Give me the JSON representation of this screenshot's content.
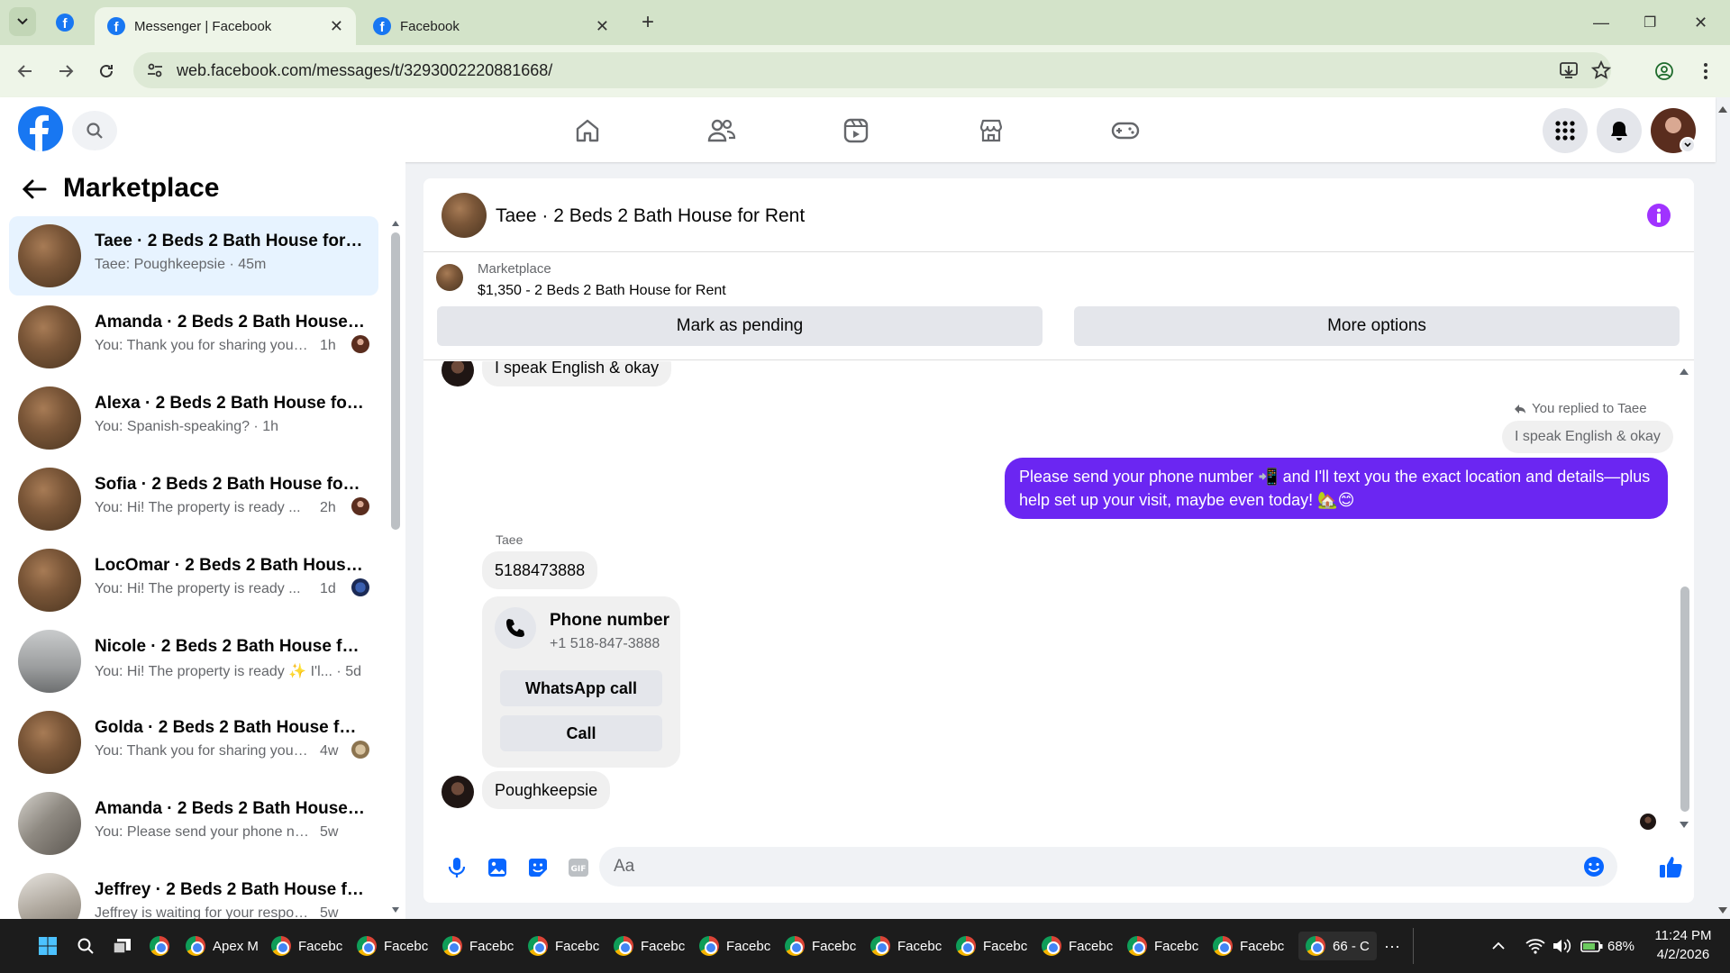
{
  "browser": {
    "tabs": [
      {
        "title": "Messenger | Facebook",
        "active": true
      },
      {
        "title": "Facebook",
        "active": false
      }
    ],
    "url": "web.facebook.com/messages/t/3293002220881668/",
    "colors": {
      "frame": "#d3e3c9",
      "toolbar": "#eef5e8"
    }
  },
  "fb": {
    "brand_color": "#1877f2",
    "nav_icons": [
      "home-icon",
      "friends-icon",
      "video-icon",
      "marketplace-icon",
      "gaming-icon"
    ],
    "right_icons": [
      "menu-grid-icon",
      "notifications-bell-icon",
      "account-avatar"
    ]
  },
  "sidebar": {
    "title": "Marketplace",
    "conversations": [
      {
        "name": "Taee · 2 Beds 2 Bath House for Rent",
        "preview": "Taee: Poughkeepsie",
        "time": "45m",
        "selected": true
      },
      {
        "name": "Amanda · 2 Beds 2 Bath House for Rent",
        "preview": "You: Thank you for sharing your ...",
        "time": "1h"
      },
      {
        "name": "Alexa · 2 Beds 2 Bath House for Rent",
        "preview": "You: Spanish-speaking?",
        "time": "1h"
      },
      {
        "name": "Sofia · 2 Beds 2 Bath House for Rent",
        "preview": "You: Hi! The property is ready ...",
        "time": "2h"
      },
      {
        "name": "LocOmar · 2 Beds 2 Bath House for Rent",
        "preview": "You: Hi! The property is ready ...",
        "time": "1d"
      },
      {
        "name": "Nicole · 2 Beds 2 Bath House for Rent",
        "preview": "You: Hi! The property is ready ✨ I'l...",
        "time": "5d"
      },
      {
        "name": "Golda · 2 Beds 2 Bath House for Rent",
        "preview": "You: Thank you for sharing your ...",
        "time": "4w"
      },
      {
        "name": "Amanda · 2 Beds 2 Bath House for Rent",
        "preview": "You: Please send your phone numb...",
        "time": "5w"
      },
      {
        "name": "Jeffrey · 2 Beds 2 Bath House for Rent",
        "preview": "Jeffrey is waiting for your response",
        "time": "5w"
      }
    ]
  },
  "chat": {
    "title": "Taee · 2 Beds 2 Bath House for Rent",
    "marketplace": {
      "label": "Marketplace",
      "listing": "$1,350 - 2 Beds 2 Bath House for Rent",
      "pending_button": "Mark as pending",
      "more_button": "More options"
    },
    "messages": {
      "incoming_top": "I speak English & okay",
      "reply_note": "You replied to Taee",
      "quoted": "I speak English & okay",
      "outgoing": "Please send your phone number 📲 and I'll text you the exact location and details—plus help set up your visit, maybe even today! 🏡😊",
      "sender_name": "Taee",
      "phone_text": "5188473888",
      "phone_card": {
        "title": "Phone number",
        "number": "+1 518-847-3888",
        "whatsapp_button": "WhatsApp call",
        "call_button": "Call"
      },
      "last": "Poughkeepsie"
    },
    "composer_placeholder": "Aa",
    "accent": "#6b26f2"
  },
  "taskbar": {
    "apps": [
      "Apex M",
      "Facebc",
      "Facebc",
      "Facebc",
      "Facebc",
      "Facebc",
      "Facebc",
      "Facebc",
      "Facebc",
      "Facebc",
      "Facebc",
      "Facebc",
      "Facebc",
      "66 - C"
    ],
    "more": "···",
    "battery": "68%",
    "time": "11:24 PM",
    "date": "4/2/2026"
  }
}
